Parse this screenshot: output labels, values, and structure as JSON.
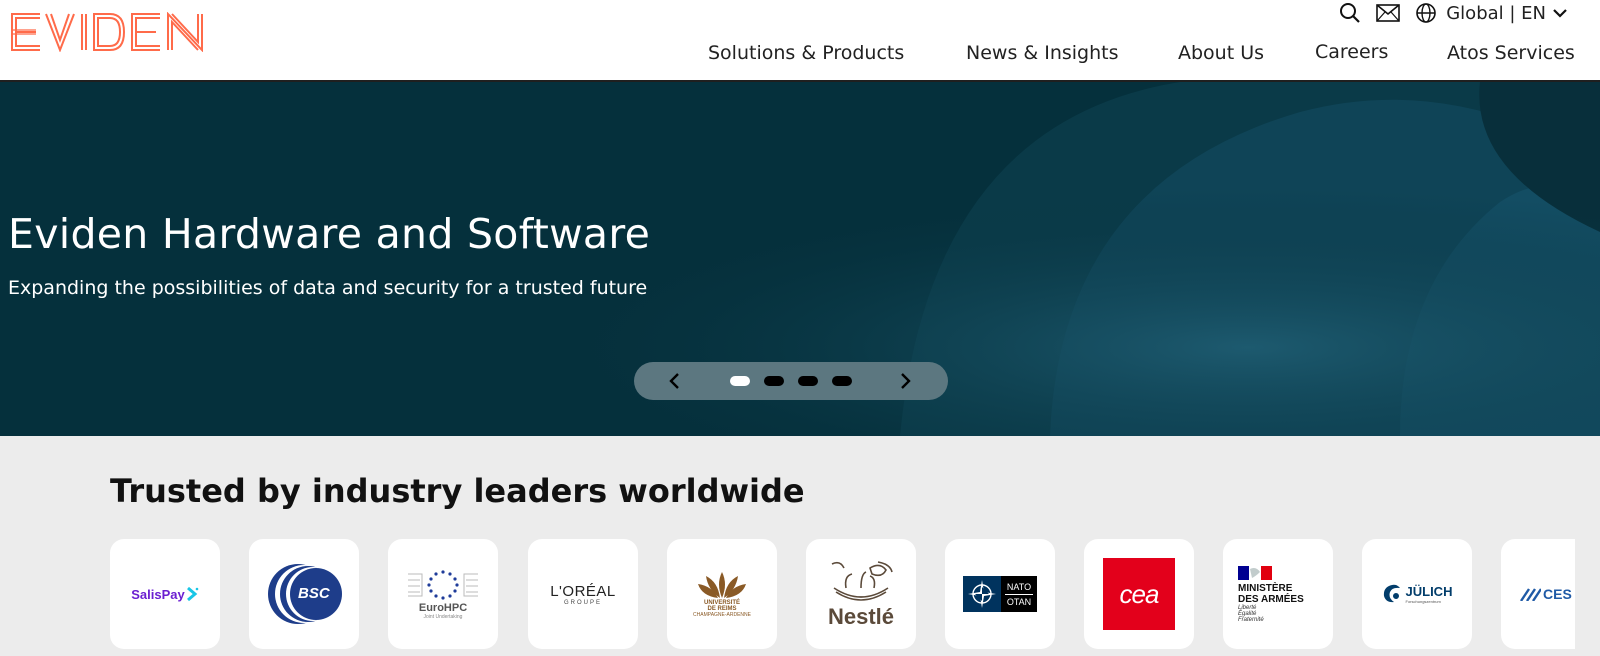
{
  "brand": {
    "name": "EVIDEN",
    "accent": "#ff6b4a"
  },
  "utility": {
    "icons": [
      "search-icon",
      "mail-icon",
      "globe-icon",
      "chevron-down-icon"
    ],
    "language": "Global | EN"
  },
  "nav": {
    "items": [
      "Solutions & Products",
      "News & Insights",
      "About Us",
      "Careers",
      "Atos Services"
    ]
  },
  "hero": {
    "title": "Eviden Hardware and Software",
    "subtitle": "Expanding the possibilities of data and security for a trusted future",
    "slides": {
      "count": 4,
      "active": 1
    },
    "background": "#06313d"
  },
  "trusted": {
    "title": "Trusted by industry leaders worldwide",
    "logos": [
      {
        "name": "salispay",
        "text": "SalisPay"
      },
      {
        "name": "bsc",
        "text": "BSC"
      },
      {
        "name": "eurohpc",
        "text": "EuroHPC",
        "sub": "Joint Undertaking"
      },
      {
        "name": "loreal",
        "text": "L'ORÉAL",
        "sub": "GROUPE"
      },
      {
        "name": "universite-reims",
        "text": "UNIVERSITÉ",
        "sub": "DE REIMS",
        "sub2": "CHAMPAGNE-ARDENNE"
      },
      {
        "name": "nestle",
        "text": "Nestlé"
      },
      {
        "name": "nato",
        "text": "NATO",
        "sub": "OTAN"
      },
      {
        "name": "cea",
        "text": "cea"
      },
      {
        "name": "ministere",
        "text": "MINISTÈRE",
        "sub": "DES ARMÉES",
        "motto": [
          "Liberté",
          "Égalité",
          "Fraternité"
        ]
      },
      {
        "name": "julich",
        "text": "JÜLICH",
        "sub": "Forschungszentrum"
      },
      {
        "name": "cesga",
        "text": "CES"
      }
    ]
  }
}
